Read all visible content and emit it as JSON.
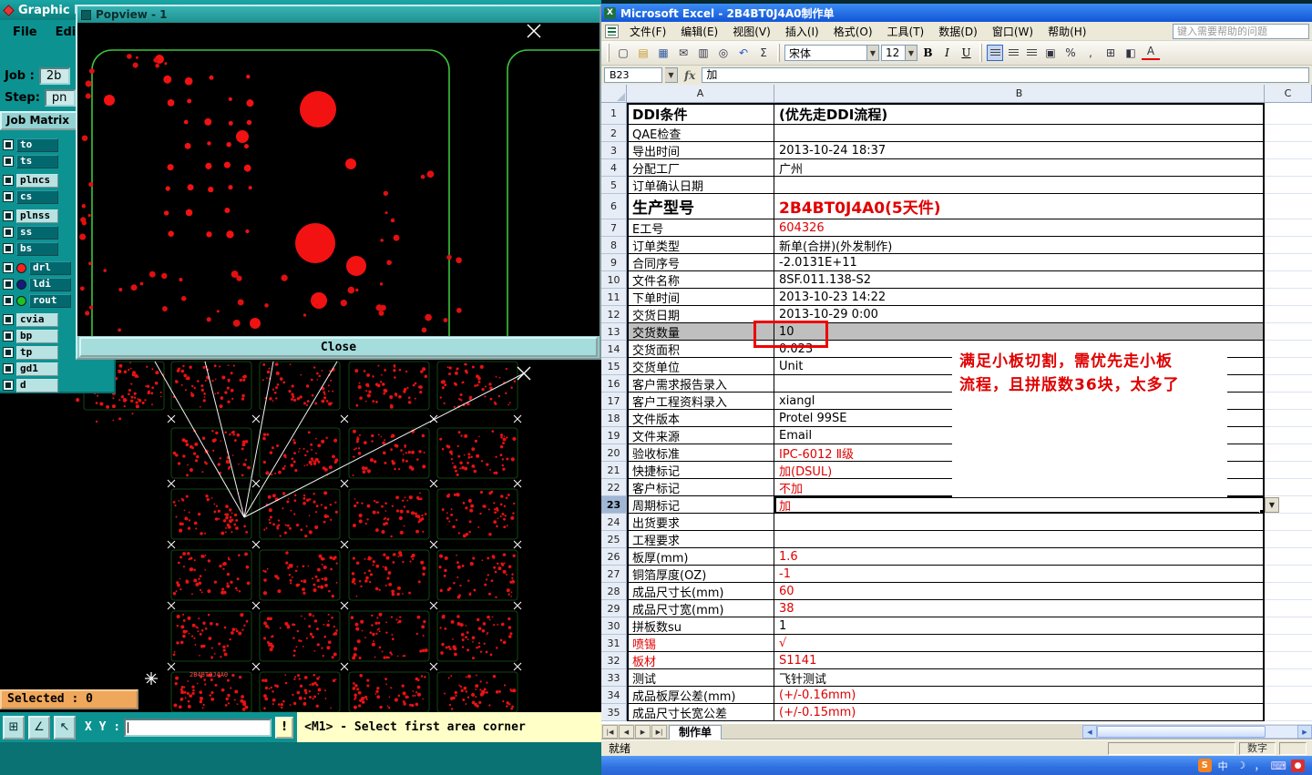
{
  "left_app": {
    "title": "Graphic Ed",
    "menus": [
      "File",
      "Edit"
    ],
    "job": {
      "label": "Job :",
      "value": "2b"
    },
    "step": {
      "label": "Step:",
      "value": "pn"
    },
    "job_matrix_label": "Job Matrix",
    "layers": [
      {
        "name": "to",
        "highlighted": true,
        "dot": ""
      },
      {
        "name": "ts",
        "highlighted": true,
        "dot": ""
      },
      {
        "name": "plncs",
        "highlighted": false,
        "dot": ""
      },
      {
        "name": "cs",
        "highlighted": true,
        "dot": ""
      },
      {
        "name": "plnss",
        "highlighted": false,
        "dot": ""
      },
      {
        "name": "ss",
        "highlighted": true,
        "dot": ""
      },
      {
        "name": "bs",
        "highlighted": true,
        "dot": ""
      },
      {
        "name": "drl",
        "highlighted": true,
        "dot": "#ff2020"
      },
      {
        "name": "ldi",
        "highlighted": true,
        "dot": "#1a1a7a"
      },
      {
        "name": "rout",
        "highlighted": true,
        "dot": "#22c022"
      },
      {
        "name": "cvia",
        "highlighted": false,
        "dot": ""
      },
      {
        "name": "bp",
        "highlighted": false,
        "dot": ""
      },
      {
        "name": "tp",
        "highlighted": false,
        "dot": ""
      },
      {
        "name": "gd1",
        "highlighted": false,
        "dot": ""
      },
      {
        "name": "d",
        "highlighted": false,
        "dot": ""
      }
    ],
    "popview": {
      "title": "Popview - 1",
      "close_label": "Close"
    },
    "canvas_label": "2B4BT0J4A0",
    "tools": [
      {
        "name": "select-tool",
        "glyph": "↖"
      },
      {
        "name": "measure-tool",
        "glyph": "∠"
      },
      {
        "name": "grid-tool",
        "glyph": "⊞"
      }
    ],
    "selected_status": "Selected : 0",
    "xy_label": "X Y :",
    "warn_label": "!",
    "prompt_message": "<M1> - Select first area corner"
  },
  "excel": {
    "title": "Microsoft Excel - 2B4BT0J4A0制作单",
    "menus": [
      "文件(F)",
      "编辑(E)",
      "视图(V)",
      "插入(I)",
      "格式(O)",
      "工具(T)",
      "数据(D)",
      "窗口(W)",
      "帮助(H)"
    ],
    "help_box": "键入需要帮助的问题",
    "toolbar_buttons": [
      {
        "name": "new",
        "glyph": "▢"
      },
      {
        "name": "open",
        "glyph": "▤"
      },
      {
        "name": "save",
        "glyph": "▦"
      },
      {
        "name": "email",
        "glyph": "✉"
      },
      {
        "name": "print",
        "glyph": "▥"
      },
      {
        "name": "print-preview",
        "glyph": "◎"
      },
      {
        "name": "undo",
        "glyph": "↶"
      },
      {
        "name": "sum",
        "glyph": "Σ"
      }
    ],
    "toolbar_buttons2": [
      {
        "name": "merge-center",
        "glyph": "▣"
      },
      {
        "name": "percent",
        "glyph": "%"
      },
      {
        "name": "comma",
        "glyph": ","
      },
      {
        "name": "borders",
        "glyph": "⊞"
      },
      {
        "name": "fill-color",
        "glyph": "◧"
      },
      {
        "name": "font-color",
        "glyph": "A"
      }
    ],
    "toolbar": {
      "font_name": "宋体",
      "font_size": "12",
      "bold": "B",
      "italic": "I",
      "underline": "U"
    },
    "name_box": "B23",
    "fx_label": "fx",
    "formula_value": "加",
    "column_headers": [
      "A",
      "B",
      "C"
    ],
    "rows": [
      {
        "n": 1,
        "label": "DDI条件",
        "value": "(优先走DDI流程)",
        "style": "xl"
      },
      {
        "n": 2,
        "label": "QAE检查",
        "value": ""
      },
      {
        "n": 3,
        "label": "导出时间",
        "value": "2013-10-24 18:37"
      },
      {
        "n": 4,
        "label": "分配工厂",
        "value": "广州"
      },
      {
        "n": 5,
        "label": "订单确认日期",
        "value": ""
      },
      {
        "n": 6,
        "label": "生产型号",
        "value": "2B4BT0J4A0(5天件)",
        "style": "big",
        "value_red": true
      },
      {
        "n": 7,
        "label": "E工号",
        "value": "604326",
        "value_red": true
      },
      {
        "n": 8,
        "label": "订单类型",
        "value": "新单(合拼)(外发制作)"
      },
      {
        "n": 9,
        "label": "合同序号",
        "value": "-2.0131E+11"
      },
      {
        "n": 10,
        "label": "文件名称",
        "value": "8SF.011.138-S2"
      },
      {
        "n": 11,
        "label": "下单时间",
        "value": "2013-10-23 14:22"
      },
      {
        "n": 12,
        "label": "交货日期",
        "value": "2013-10-29 0:00"
      },
      {
        "n": 13,
        "label": "交货数量",
        "value": "10",
        "gray": true
      },
      {
        "n": 14,
        "label": "交货面积",
        "value": "0.023"
      },
      {
        "n": 15,
        "label": "交货单位",
        "value": "Unit"
      },
      {
        "n": 16,
        "label": "客户需求报告录入",
        "value": ""
      },
      {
        "n": 17,
        "label": "客户工程资料录入",
        "value": "xiangl"
      },
      {
        "n": 18,
        "label": "文件版本",
        "value": "Protel 99SE"
      },
      {
        "n": 19,
        "label": "文件来源",
        "value": "Email"
      },
      {
        "n": 20,
        "label": "验收标准",
        "value": "IPC-6012 Ⅱ级",
        "value_red": true
      },
      {
        "n": 21,
        "label": "快捷标记",
        "value": "加(DSUL)",
        "value_red": true
      },
      {
        "n": 22,
        "label": "客户标记",
        "value": "不加",
        "value_red": true
      },
      {
        "n": 23,
        "label": "周期标记",
        "value": "加",
        "value_red": true,
        "selected": true
      },
      {
        "n": 24,
        "label": "出货要求",
        "value": ""
      },
      {
        "n": 25,
        "label": "工程要求",
        "value": ""
      },
      {
        "n": 26,
        "label": "板厚(mm)",
        "value": "1.6",
        "value_red": true
      },
      {
        "n": 27,
        "label": "铜箔厚度(OZ)",
        "value": "-1",
        "value_red": true
      },
      {
        "n": 28,
        "label": "成品尺寸长(mm)",
        "value": "60",
        "value_red": true
      },
      {
        "n": 29,
        "label": "成品尺寸宽(mm)",
        "value": "38",
        "value_red": true
      },
      {
        "n": 30,
        "label": "拼板数su",
        "value": "1"
      },
      {
        "n": 31,
        "label": "喷锡",
        "value": "√",
        "label_red": true,
        "value_red": true
      },
      {
        "n": 32,
        "label": "板材",
        "value": "S1141",
        "label_red": true,
        "value_red": true
      },
      {
        "n": 33,
        "label": "测试",
        "value": "飞针测试"
      },
      {
        "n": 34,
        "label": "成品板厚公差(mm)",
        "value": "(+/-0.16mm)",
        "value_red": true
      },
      {
        "n": 35,
        "label": "成品尺寸长宽公差",
        "value": "(+/-0.15mm)",
        "value_red": true
      }
    ],
    "annotation_lines": [
      "满足小板切割，需优先走小板",
      "流程，且拼版数36块，太多了"
    ],
    "tab_nav": [
      "|◀",
      "◀",
      "▶",
      "▶|"
    ],
    "sheet_tab": "制作单",
    "status_left": "就绪",
    "status_right": "数字"
  },
  "taskbar": {
    "icons": [
      {
        "name": "sogou-logo",
        "glyph": "S",
        "type": "sogou"
      },
      {
        "name": "input-mode-chinese",
        "glyph": "中",
        "type": ""
      },
      {
        "name": "fullwidth-toggle",
        "glyph": "☽",
        "type": ""
      },
      {
        "name": "punctuation-toggle",
        "glyph": "，",
        "type": ""
      },
      {
        "name": "soft-keyboard",
        "glyph": "⌨",
        "type": "kbd"
      },
      {
        "name": "tray-app",
        "glyph": "●",
        "type": "redsq"
      }
    ]
  }
}
